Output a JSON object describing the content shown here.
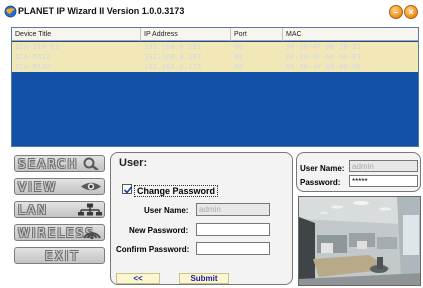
{
  "app": {
    "title": "PLANET IP Wizard II  Version 1.0.0.3173"
  },
  "window_controls": {
    "minimize_glyph": "–",
    "close_glyph": "×"
  },
  "device_table": {
    "columns": [
      "Device Title",
      "IP Address",
      "Port",
      "MAC"
    ],
    "rows": [
      {
        "title": "ICA-310-E3",
        "ip": "192.168.0.101",
        "port": "80",
        "mac": "00-30-4F-6B-2B-22"
      },
      {
        "title": "ICA-M312",
        "ip": "192.168.0.102",
        "port": "80",
        "mac": "00-30-4F-A0-00-E3"
      },
      {
        "title": "ICA-M130",
        "ip": "192.168.0.115",
        "port": "80",
        "mac": "00-30-4F-A0-00-0B"
      }
    ]
  },
  "nav": {
    "search": "SEARCH",
    "view": "VIEW",
    "lan": "LAN",
    "wireless": "WIRELESS",
    "exit": "EXIT"
  },
  "user_form": {
    "title": "User:",
    "change_password_label": "Change Password",
    "change_password_checked": true,
    "username_label": "User Name:",
    "username_value": "admin",
    "new_password_label": "New Password:",
    "new_password_value": "",
    "confirm_password_label": "Confirm Password:",
    "confirm_password_value": "",
    "back_label": "<<",
    "submit_label": "Submit"
  },
  "login": {
    "username_label": "User Name:",
    "username_value": "admin",
    "password_label": "Password:",
    "password_value": "*****"
  },
  "colors": {
    "table_selection": "#1350a8",
    "row_highlight": "#f2e7b7",
    "link_text": "#1a1aa8",
    "window_button": "#f29b2a"
  }
}
